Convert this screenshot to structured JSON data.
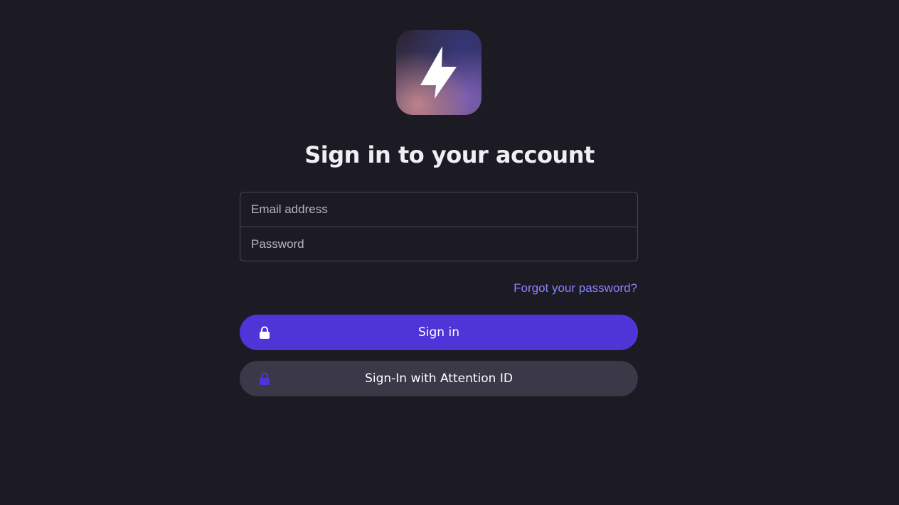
{
  "logo": {
    "icon": "lightning-bolt-icon",
    "colors": {
      "bolt": "#ffffff",
      "gradient": [
        "#2b2535",
        "#3a3356",
        "#6c5a86",
        "#c4868c"
      ]
    }
  },
  "header": {
    "title": "Sign in to your account"
  },
  "form": {
    "email": {
      "value": "",
      "placeholder": "Email address"
    },
    "password": {
      "value": "",
      "placeholder": "Password"
    },
    "forgot_label": "Forgot your password?",
    "sign_in_label": "Sign in",
    "attention_id_label": "Sign-In with Attention ID"
  },
  "icons": {
    "sign_in": "lock-icon",
    "attention_id": "lock-icon"
  },
  "colors": {
    "background": "#1c1a23",
    "accent": "#4f35d8",
    "link": "#8a84ff",
    "secondary_button": "#3b3848",
    "secondary_lock": "#4f35d8"
  }
}
